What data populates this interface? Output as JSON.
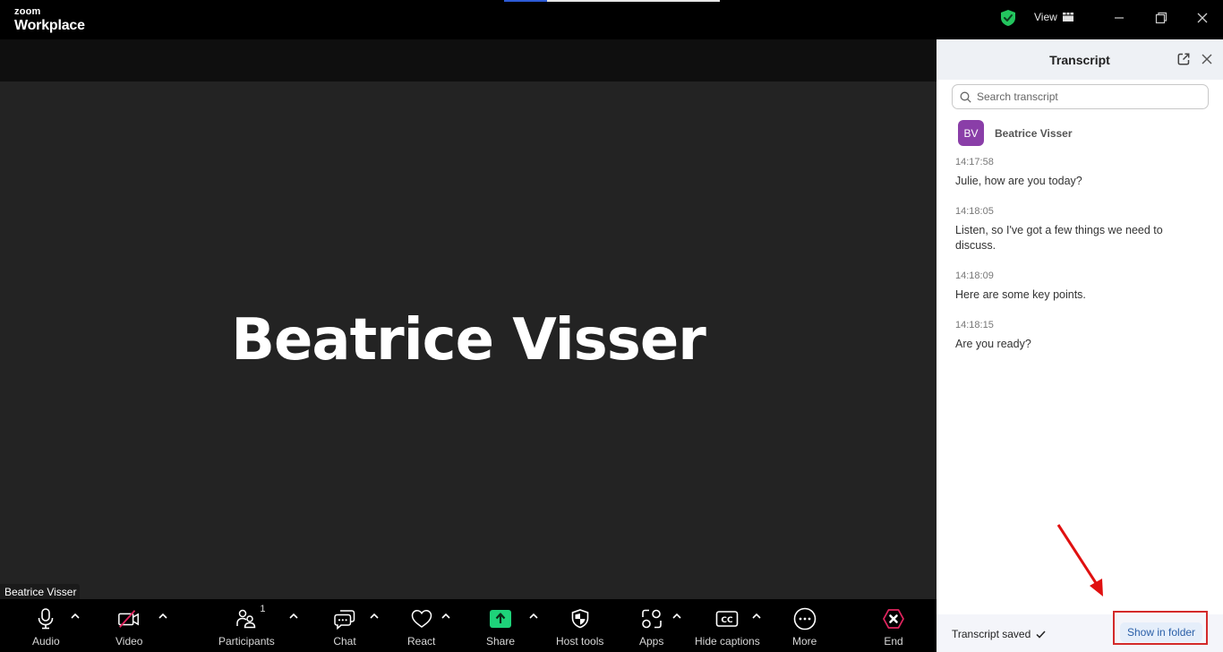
{
  "titlebar": {
    "brand_small": "zoom",
    "brand_big": "Workplace",
    "view_label": "View",
    "icons": {
      "security": "shield-check-icon",
      "view": "grid-icon",
      "minimize": "minimize-icon",
      "restore": "restore-icon",
      "close": "close-icon"
    },
    "colors": {
      "shield": "#23c55e"
    }
  },
  "stage": {
    "participant_display_name": "Beatrice Visser",
    "name_tag": "Beatrice Visser"
  },
  "toolbar": {
    "items": [
      {
        "label": "Audio",
        "icon": "microphone-icon",
        "has_caret": true
      },
      {
        "label": "Video",
        "icon": "video-off-icon",
        "has_caret": true
      },
      {
        "label": "Participants",
        "icon": "participants-icon",
        "count": "1",
        "has_caret": true
      },
      {
        "label": "Chat",
        "icon": "chat-icon",
        "has_caret": true
      },
      {
        "label": "React",
        "icon": "heart-icon",
        "has_caret": true
      },
      {
        "label": "Share",
        "icon": "share-icon",
        "has_caret": true
      },
      {
        "label": "Host tools",
        "icon": "shield-icon",
        "has_caret": false
      },
      {
        "label": "Apps",
        "icon": "apps-icon",
        "has_caret": true
      },
      {
        "label": "Hide captions",
        "icon": "cc-icon",
        "has_caret": true
      },
      {
        "label": "More",
        "icon": "more-icon",
        "has_caret": false
      },
      {
        "label": "End",
        "icon": "end-icon",
        "has_caret": false
      }
    ],
    "colors": {
      "share": "#1ed37a",
      "end": "#e0245e",
      "video_slash": "#e0245e"
    }
  },
  "transcript": {
    "title": "Transcript",
    "search_placeholder": "Search transcript",
    "speaker": {
      "initials": "BV",
      "name": "Beatrice Visser",
      "avatar_color": "#8a3ea8"
    },
    "entries": [
      {
        "time": "14:17:58",
        "text": "Julie, how are you today?"
      },
      {
        "time": "14:18:05",
        "text": "Listen, so I've got a few things we need to discuss."
      },
      {
        "time": "14:18:09",
        "text": "Here are some key points."
      },
      {
        "time": "14:18:15",
        "text": "Are you ready?"
      }
    ],
    "footer": {
      "status": "Transcript saved",
      "status_icon": "checkmark-icon",
      "show_in_folder": "Show in folder"
    }
  },
  "annotation": {
    "color": "#d32a2a"
  }
}
